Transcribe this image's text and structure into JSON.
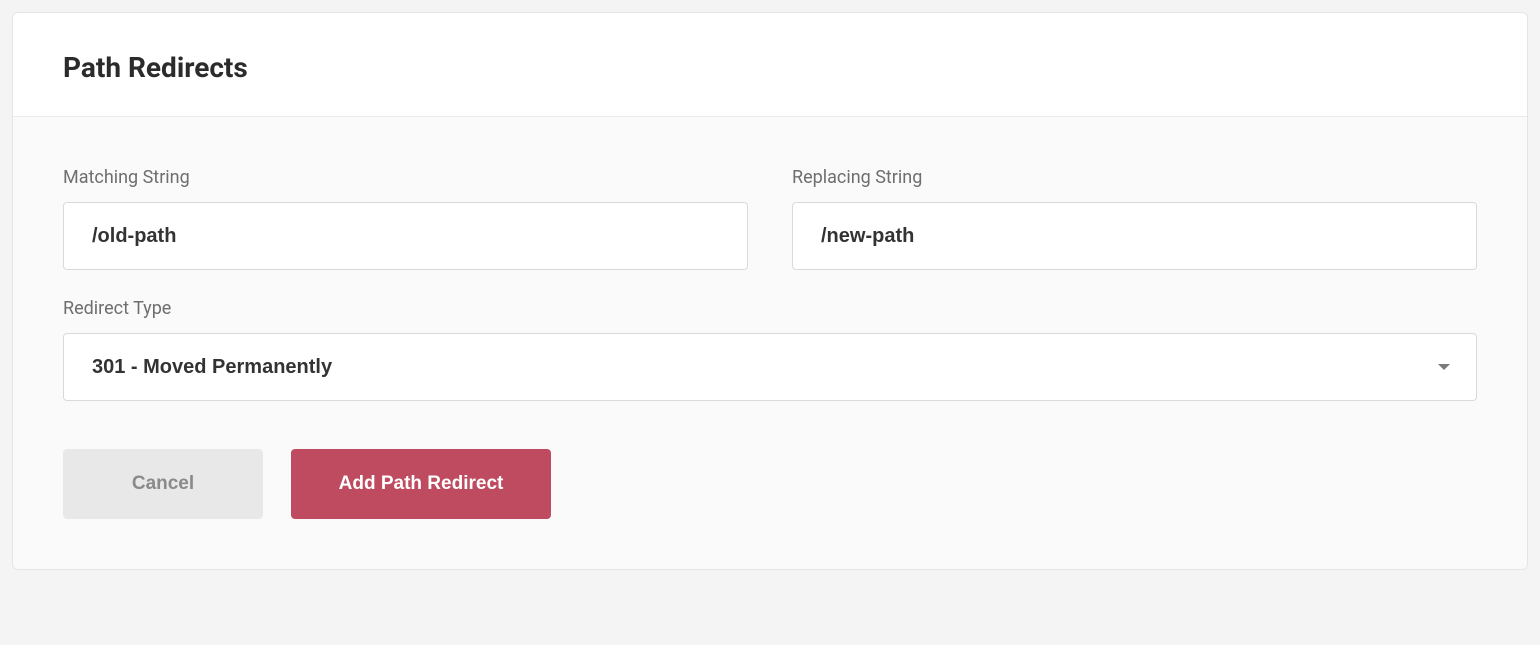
{
  "card": {
    "title": "Path Redirects"
  },
  "form": {
    "matching": {
      "label": "Matching String",
      "value": "/old-path"
    },
    "replacing": {
      "label": "Replacing String",
      "value": "/new-path"
    },
    "redirect_type": {
      "label": "Redirect Type",
      "selected": "301 - Moved Permanently"
    }
  },
  "buttons": {
    "cancel": "Cancel",
    "submit": "Add Path Redirect"
  },
  "colors": {
    "primary": "#bf4b60",
    "muted_bg": "#e8e8e8",
    "body_bg": "#fafafa"
  }
}
